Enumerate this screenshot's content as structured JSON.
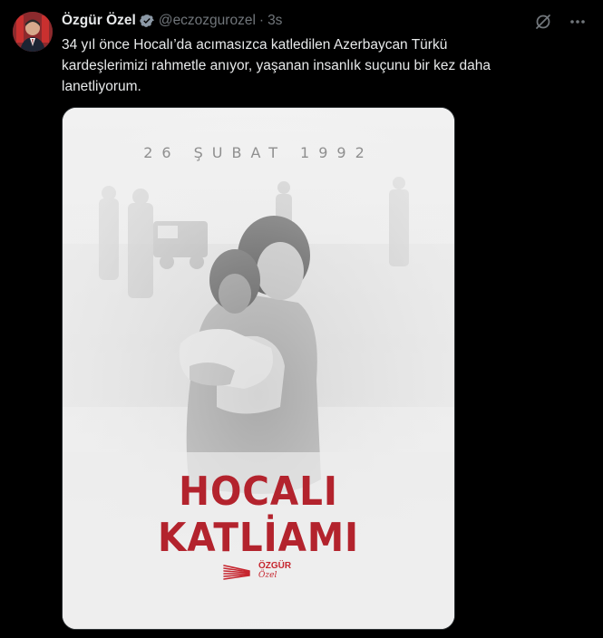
{
  "author": {
    "display_name": "Özgür Özel",
    "handle": "@eczozgurozel",
    "separator": "·",
    "time": "3s",
    "verified": true,
    "avatar_icon": "avatar-portrait"
  },
  "tweet": {
    "text_lines": [
      "34 yıl önce Hocalı’da acımasızca katledilen Azerbaycan Türkü",
      "kardeşlerimizi rahmetle anıyor, yaşanan insanlık suçunu bir kez daha",
      "lanetliyorum."
    ]
  },
  "actions": {
    "grok_icon": "grok-icon",
    "more_icon": "more-options-icon"
  },
  "poster": {
    "date": "26 ŞUBAT 1992",
    "title": "HOCALI KATLİAMI",
    "brand_name": "ÖZGÜR",
    "brand_signature": "Özel",
    "accent_color": "#b3232d"
  }
}
